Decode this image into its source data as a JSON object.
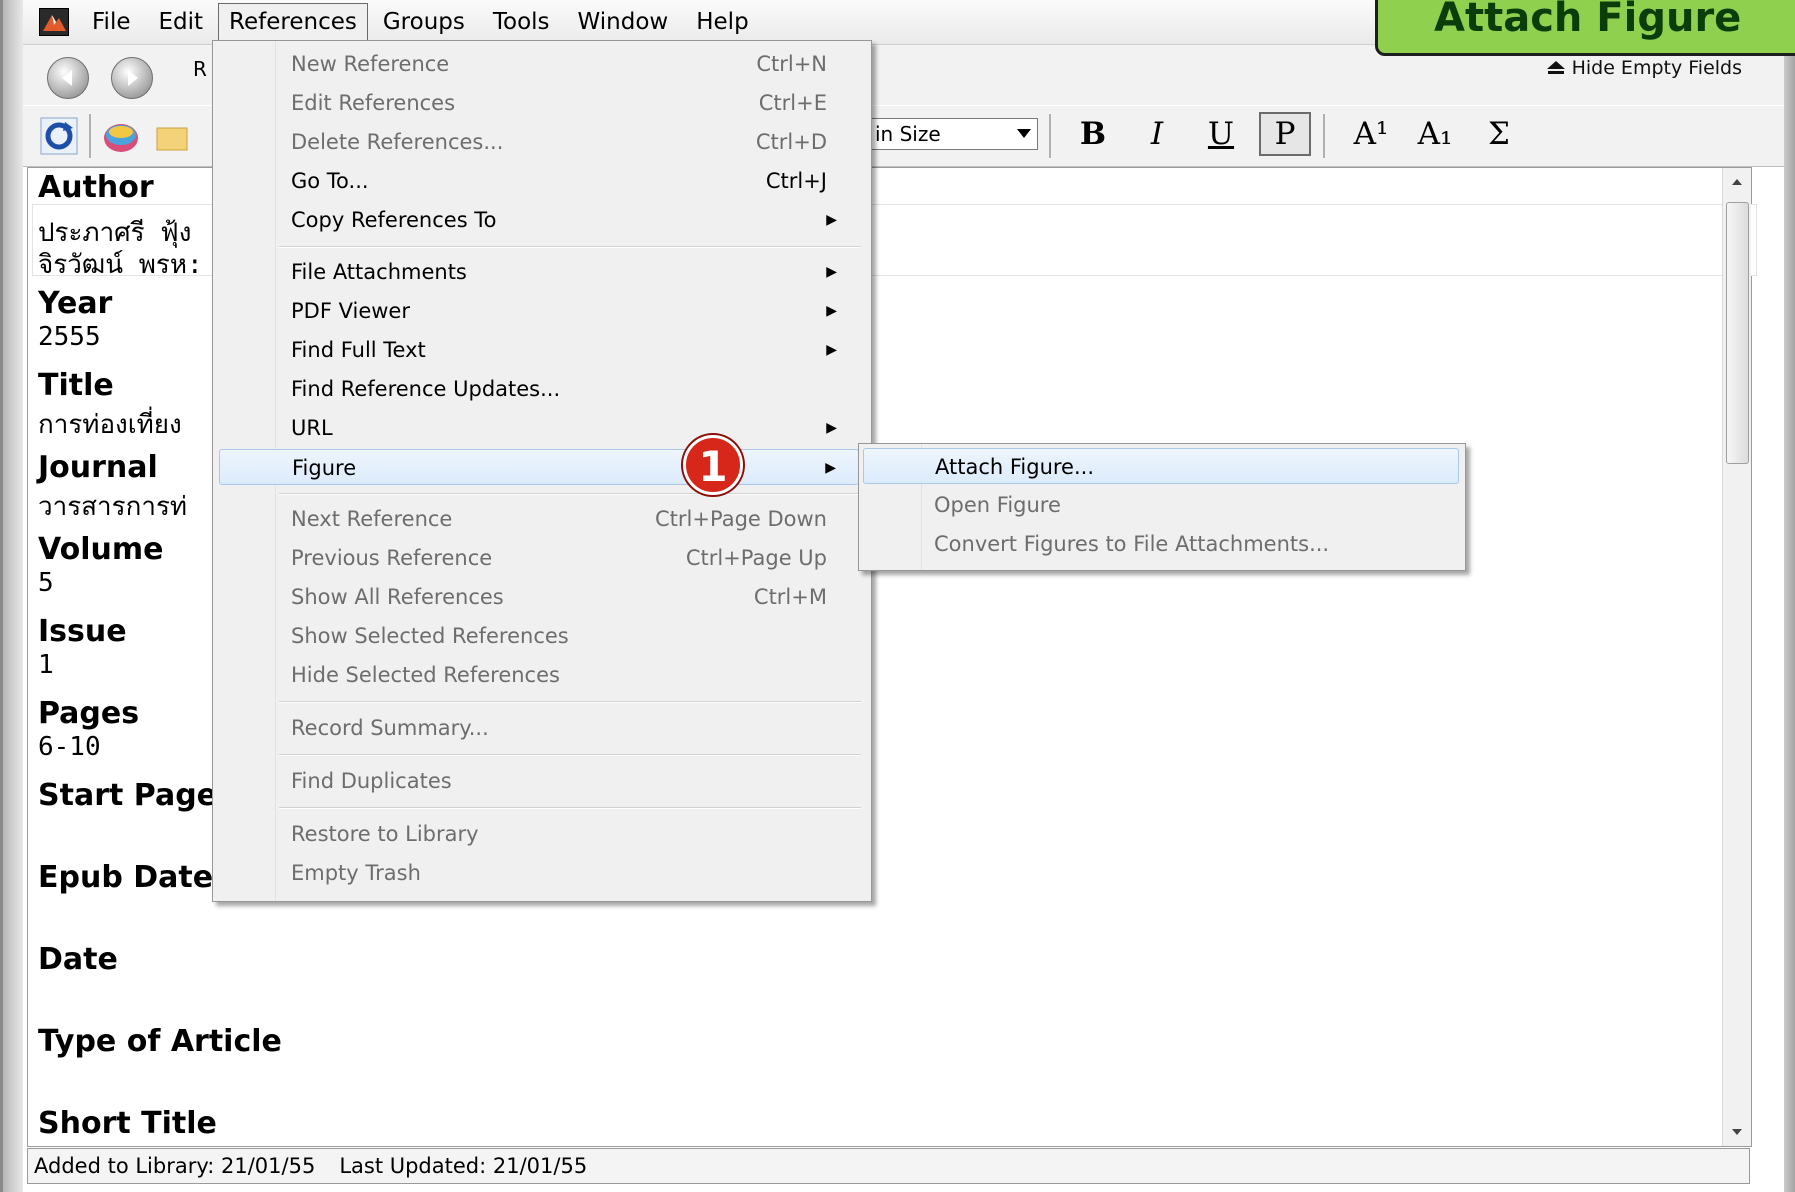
{
  "menubar": {
    "items": [
      "File",
      "Edit",
      "References",
      "Groups",
      "Tools",
      "Window",
      "Help"
    ],
    "active": "References"
  },
  "toolbar": {
    "ref_label": "R",
    "hide_empty_fields": "Hide Empty Fields",
    "font_size": "in Size",
    "format_buttons": [
      "B",
      "I",
      "U",
      "P",
      "A¹",
      "A₁",
      "Σ"
    ]
  },
  "references_menu": {
    "items": [
      {
        "label": "New Reference",
        "shortcut": "Ctrl+N",
        "disabled": true
      },
      {
        "label": "Edit References",
        "shortcut": "Ctrl+E",
        "disabled": true
      },
      {
        "label": "Delete References...",
        "shortcut": "Ctrl+D",
        "disabled": true
      },
      {
        "label": "Go To...",
        "shortcut": "Ctrl+J",
        "disabled": false
      },
      {
        "label": "Copy References To",
        "shortcut": "",
        "disabled": false
      },
      {
        "label": "File Attachments",
        "shortcut": "",
        "disabled": false
      },
      {
        "label": "PDF Viewer",
        "shortcut": "",
        "disabled": false
      },
      {
        "label": "Find Full Text",
        "shortcut": "",
        "disabled": false
      },
      {
        "label": "Find Reference Updates...",
        "shortcut": "",
        "disabled": false
      },
      {
        "label": "URL",
        "shortcut": "",
        "disabled": false
      },
      {
        "label": "Figure",
        "shortcut": "",
        "disabled": false
      },
      {
        "label": "Next Reference",
        "shortcut": "Ctrl+Page Down",
        "disabled": true
      },
      {
        "label": "Previous Reference",
        "shortcut": "Ctrl+Page Up",
        "disabled": true
      },
      {
        "label": "Show All References",
        "shortcut": "Ctrl+M",
        "disabled": true
      },
      {
        "label": "Show Selected References",
        "shortcut": "",
        "disabled": true
      },
      {
        "label": "Hide Selected References",
        "shortcut": "",
        "disabled": true
      },
      {
        "label": "Record Summary...",
        "shortcut": "",
        "disabled": true
      },
      {
        "label": "Find Duplicates",
        "shortcut": "",
        "disabled": true
      },
      {
        "label": "Restore to Library",
        "shortcut": "",
        "disabled": true
      },
      {
        "label": "Empty Trash",
        "shortcut": "",
        "disabled": true
      }
    ]
  },
  "figure_submenu": {
    "items": [
      {
        "label": "Attach Figure...",
        "disabled": false
      },
      {
        "label": "Open Figure",
        "disabled": true
      },
      {
        "label": "Convert Figures to File Attachments...",
        "disabled": true
      }
    ]
  },
  "fields": {
    "author_label": "Author",
    "author_line1": "ประภาศรี ฟุ้ง",
    "author_line2": "จิรวัฒน์ พรห:",
    "year_label": "Year",
    "year_value": "2555",
    "title_label": "Title",
    "title_value": "การท่องเที่ยง",
    "journal_label": "Journal",
    "journal_value": "วารสารการท่",
    "volume_label": "Volume",
    "volume_value": "5",
    "issue_label": "Issue",
    "issue_value": "1",
    "pages_label": "Pages",
    "pages_value": "6-10",
    "start_page_label": "Start Page",
    "epub_date_label": "Epub Date",
    "date_label": "Date",
    "type_of_article_label": "Type of Article",
    "short_title_label": "Short Title"
  },
  "status": {
    "added": "Added to Library: 21/01/55",
    "updated": "Last Updated: 21/01/55"
  },
  "annotation": {
    "step_number": "1",
    "callout_text": "Attach Figure"
  },
  "colors": {
    "callout_bg": "#8fd14f",
    "step_badge": "#d7261a",
    "menu_highlight": "#dcebfb"
  }
}
